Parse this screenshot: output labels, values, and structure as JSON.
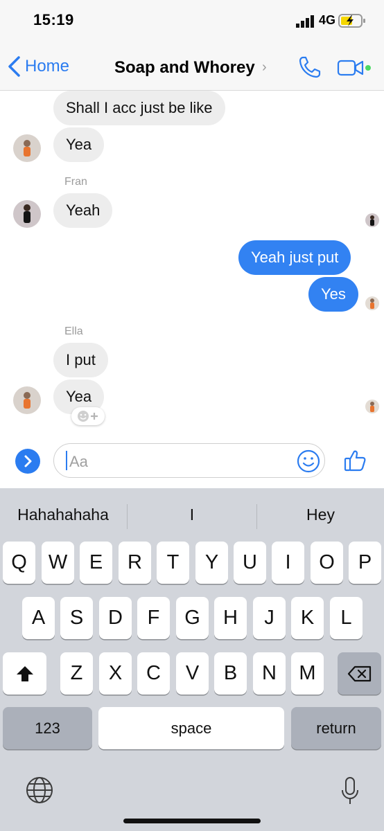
{
  "status_bar": {
    "time": "15:19",
    "network": "4G"
  },
  "nav": {
    "back_label": "Home",
    "title": "Soap and Whorey",
    "title_chevron": "›"
  },
  "messages": [
    {
      "text": "Shall I acc just be like"
    },
    {
      "text": "Yea"
    },
    {
      "sender": "Fran",
      "text": "Yeah"
    },
    {
      "text": "Yeah just put"
    },
    {
      "text": "Yes"
    },
    {
      "sender": "Ella",
      "text": "I put"
    },
    {
      "text": "Yea"
    }
  ],
  "composer": {
    "placeholder": "Aa"
  },
  "keyboard": {
    "suggestions": [
      "Hahahahaha",
      "I",
      "Hey"
    ],
    "row1": [
      "Q",
      "W",
      "E",
      "R",
      "T",
      "Y",
      "U",
      "I",
      "O",
      "P"
    ],
    "row2": [
      "A",
      "S",
      "D",
      "F",
      "G",
      "H",
      "J",
      "K",
      "L"
    ],
    "row3": [
      "Z",
      "X",
      "C",
      "V",
      "B",
      "N",
      "M"
    ],
    "numbers_label": "123",
    "space_label": "space",
    "return_label": "return"
  },
  "colors": {
    "accent": "#2b7cf0",
    "outgoing_bubble": "#3282f2",
    "incoming_bubble": "#ededed",
    "online_dot": "#4cd964"
  }
}
